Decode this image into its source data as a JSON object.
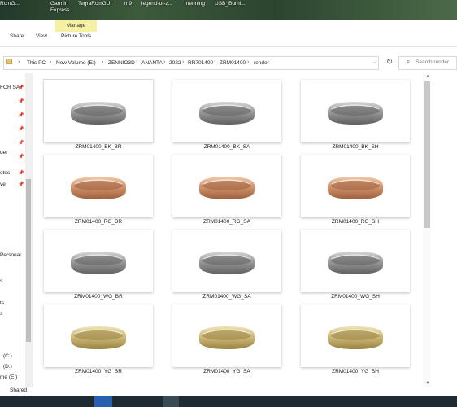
{
  "desktop": {
    "icons": [
      "RcmG...",
      "Garmin Express",
      "TegraRcmGUI",
      "m9",
      "legend-of-z...",
      "menning",
      "USB_Burni..."
    ]
  },
  "ribbon": {
    "context_header": "Manage",
    "tabs": [
      "Share",
      "View",
      "Picture Tools"
    ]
  },
  "address": {
    "crumbs": [
      "This PC",
      "New Volume (E:)",
      "ZENNIO3D",
      "ANANTA",
      "2022",
      "RR701400",
      "ZRM01400",
      "render"
    ],
    "search_placeholder": "Search render"
  },
  "navpane": {
    "items": [
      "FOR SA",
      "der",
      "otos",
      "ve",
      "Personal",
      "s",
      "ts",
      "s",
      "(C:)",
      "(D:)",
      "me (E:)"
    ],
    "status_item": "Shared"
  },
  "files": [
    {
      "name": "ZRM01400_BK_BR",
      "metal": "white"
    },
    {
      "name": "ZRM01400_BK_SA",
      "metal": "white"
    },
    {
      "name": "ZRM01400_BK_SH",
      "metal": "white"
    },
    {
      "name": "ZRM01400_RG_BR",
      "metal": "rose"
    },
    {
      "name": "ZRM01400_RG_SA",
      "metal": "rose"
    },
    {
      "name": "ZRM01400_RG_SH",
      "metal": "rose"
    },
    {
      "name": "ZRM01400_WG_BR",
      "metal": "white"
    },
    {
      "name": "ZRM01400_WG_SA",
      "metal": "white"
    },
    {
      "name": "ZRM01400_WG_SH",
      "metal": "white"
    },
    {
      "name": "ZRM01400_YG_BR",
      "metal": "yellow"
    },
    {
      "name": "ZRM01400_YG_SA",
      "metal": "yellow"
    },
    {
      "name": "ZRM01400_YG_SH",
      "metal": "yellow"
    }
  ],
  "colors": {
    "accent": "#0078d7",
    "context_tab": "#f6f0a4",
    "white_metal": "#a9a9a9",
    "rose_metal": "#d9a67f",
    "yellow_metal": "#d9c98e"
  },
  "icons": [
    "folder-icon",
    "search-icon",
    "refresh-icon",
    "pin-icon",
    "chevron-down-icon",
    "back-arrow-icon",
    "forward-arrow-icon",
    "up-arrow-icon"
  ]
}
